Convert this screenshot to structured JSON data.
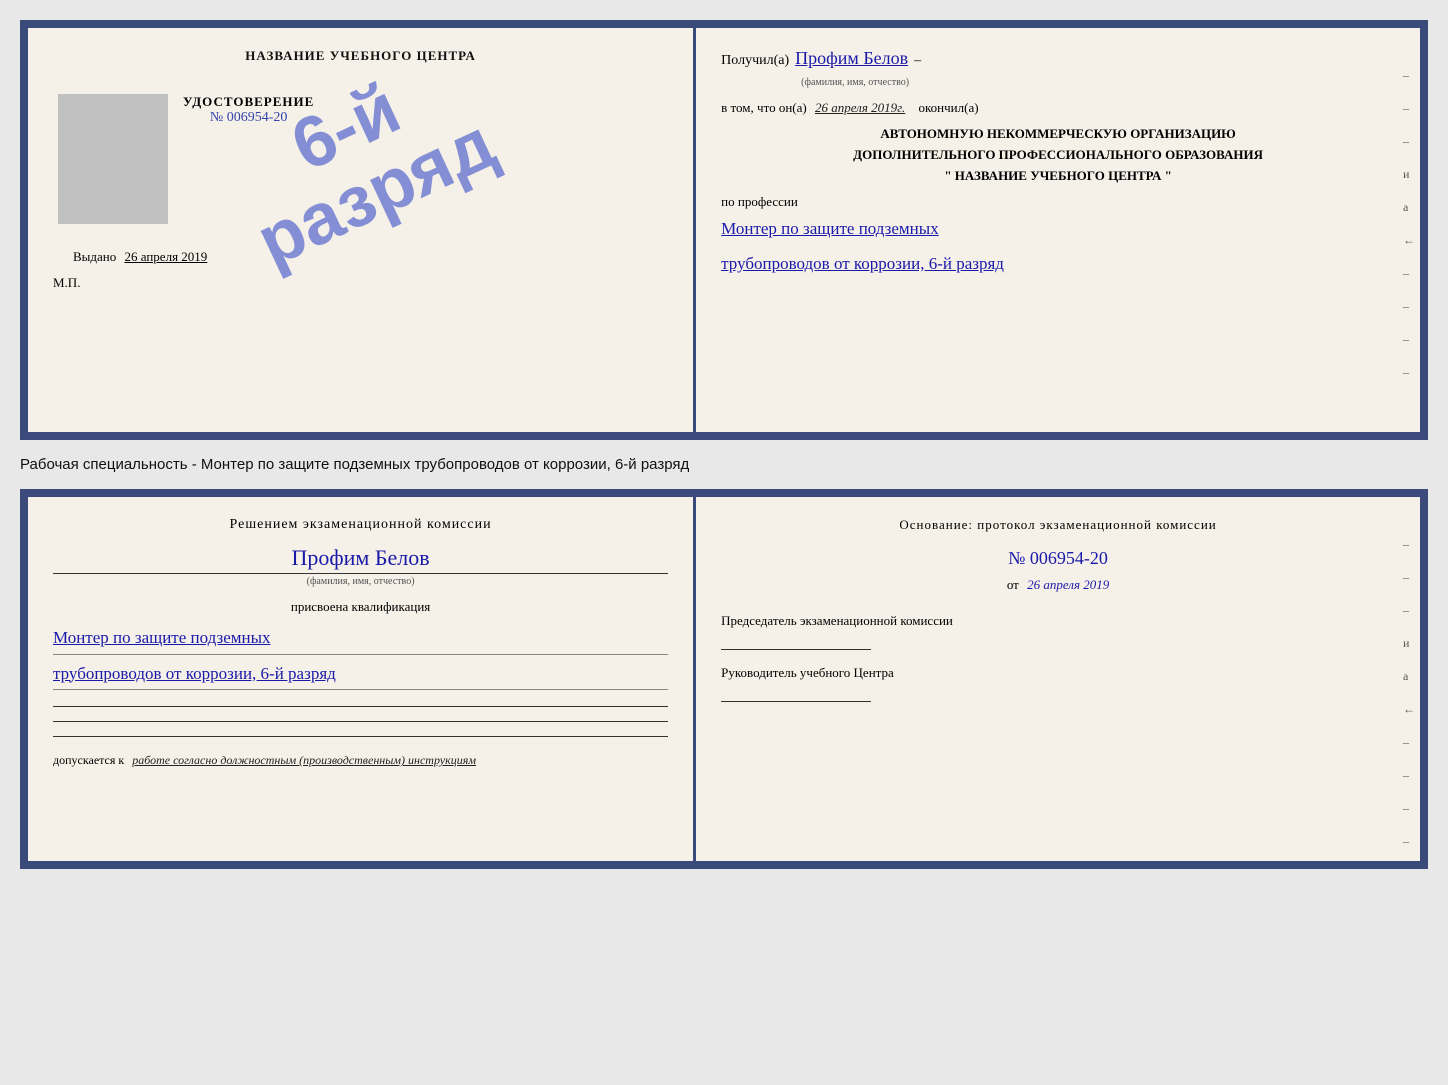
{
  "page": {
    "background": "#e8e8e8"
  },
  "top_document": {
    "left": {
      "institution_name": "НАЗВАНИЕ УЧЕБНОГО ЦЕНТРА",
      "stamp_text": "6-й разряд",
      "cert_title": "УДОСТОВЕРЕНИЕ",
      "cert_number": "№ 006954-20",
      "issued_label": "Выдано",
      "issued_date": "26 апреля 2019",
      "mp_label": "М.П."
    },
    "right": {
      "received_label": "Получил(а)",
      "received_name": "Профим Белов",
      "received_name_label": "(фамилия, имя, отчество)",
      "dash": "–",
      "in_that_label": "в том, что он(а)",
      "completed_date": "26 апреля 2019г.",
      "completed_label": "окончил(а)",
      "org_line1": "АВТОНОМНУЮ НЕКОММЕРЧЕСКУЮ ОРГАНИЗАЦИЮ",
      "org_line2": "ДОПОЛНИТЕЛЬНОГО ПРОФЕССИОНАЛЬНОГО ОБРАЗОВАНИЯ",
      "org_line3": "\"  НАЗВАНИЕ УЧЕБНОГО ЦЕНТРА  \"",
      "and_label": "и",
      "profession_label": "по профессии",
      "profession_line1": "Монтер по защите подземных",
      "profession_line2": "трубопроводов от коррозии, 6-й разряд",
      "side_dashes": [
        "-",
        "-",
        "-",
        "и",
        "а",
        "←",
        "-",
        "-",
        "-",
        "-"
      ]
    }
  },
  "label_text": "Рабочая специальность - Монтер по защите подземных трубопроводов от коррозии, 6-й разряд",
  "bottom_document": {
    "left": {
      "decision_title": "Решением экзаменационной комиссии",
      "person_name": "Профим Белов",
      "person_name_label": "(фамилия, имя, отчество)",
      "assigned_label": "присвоена квалификация",
      "qual_line1": "Монтер по защите подземных",
      "qual_line2": "трубопроводов от коррозии, 6-й разряд",
      "admission_prefix": "допускается к",
      "admission_text": "работе согласно должностным (производственным) инструкциям"
    },
    "right": {
      "basis_title": "Основание: протокол экзаменационной комиссии",
      "protocol_number": "№  006954-20",
      "from_label": "от",
      "from_date": "26 апреля 2019",
      "chairman_title": "Председатель экзаменационной комиссии",
      "head_title": "Руководитель учебного Центра",
      "side_dashes": [
        "-",
        "-",
        "-",
        "и",
        "а",
        "←",
        "-",
        "-",
        "-",
        "-"
      ]
    }
  }
}
